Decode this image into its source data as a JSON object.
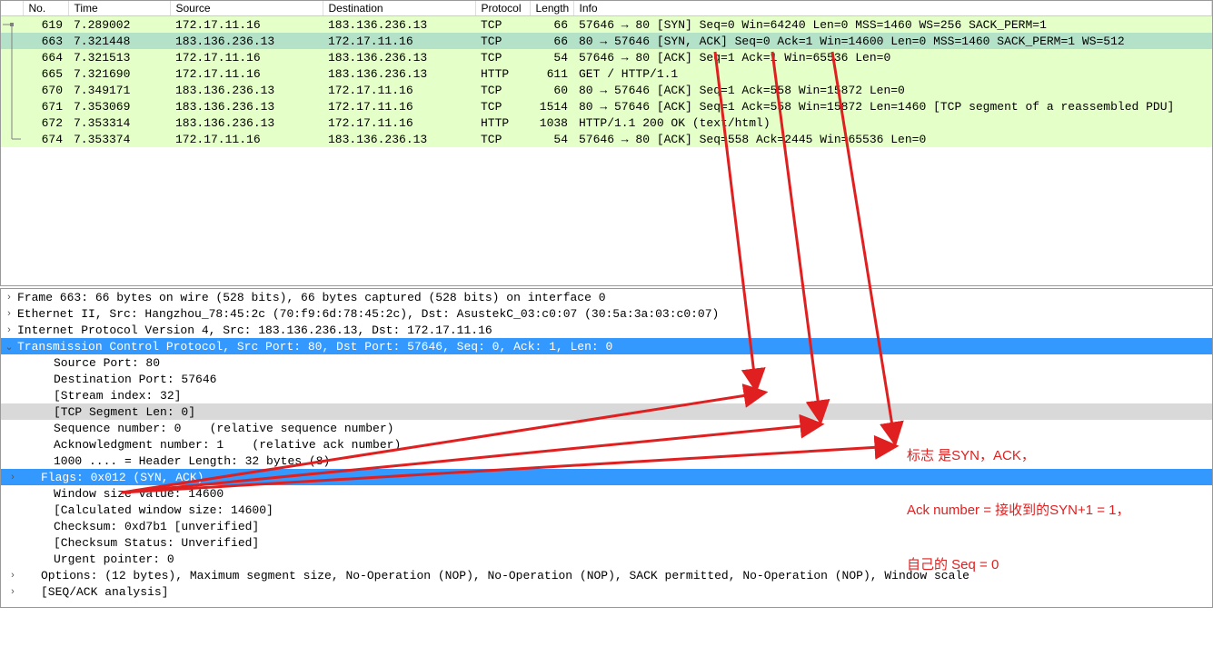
{
  "packet_list": {
    "headers": {
      "no": "No.",
      "time": "Time",
      "source": "Source",
      "destination": "Destination",
      "protocol": "Protocol",
      "length": "Length",
      "info": "Info"
    },
    "rows": [
      {
        "glyph": "start",
        "cls": "row-green",
        "no": "619",
        "time": "7.289002",
        "src": "172.17.11.16",
        "dst": "183.136.236.13",
        "proto": "TCP",
        "len": "66",
        "info": "57646 → 80 [SYN] Seq=0 Win=64240 Len=0 MSS=1460 WS=256 SACK_PERM=1"
      },
      {
        "glyph": "mid",
        "cls": "row-teal",
        "no": "663",
        "time": "7.321448",
        "src": "183.136.236.13",
        "dst": "172.17.11.16",
        "proto": "TCP",
        "len": "66",
        "info": "80 → 57646 [SYN, ACK] Seq=0 Ack=1 Win=14600 Len=0 MSS=1460 SACK_PERM=1 WS=512"
      },
      {
        "glyph": "mid",
        "cls": "row-green",
        "no": "664",
        "time": "7.321513",
        "src": "172.17.11.16",
        "dst": "183.136.236.13",
        "proto": "TCP",
        "len": "54",
        "info": "57646 → 80 [ACK] Seq=1 Ack=1 Win=65536 Len=0"
      },
      {
        "glyph": "mid",
        "cls": "row-green",
        "no": "665",
        "time": "7.321690",
        "src": "172.17.11.16",
        "dst": "183.136.236.13",
        "proto": "HTTP",
        "len": "611",
        "info": "GET / HTTP/1.1 "
      },
      {
        "glyph": "mid",
        "cls": "row-green",
        "no": "670",
        "time": "7.349171",
        "src": "183.136.236.13",
        "dst": "172.17.11.16",
        "proto": "TCP",
        "len": "60",
        "info": "80 → 57646 [ACK] Seq=1 Ack=558 Win=15872 Len=0"
      },
      {
        "glyph": "mid",
        "cls": "row-green",
        "no": "671",
        "time": "7.353069",
        "src": "183.136.236.13",
        "dst": "172.17.11.16",
        "proto": "TCP",
        "len": "1514",
        "info": "80 → 57646 [ACK] Seq=1 Ack=558 Win=15872 Len=1460 [TCP segment of a reassembled PDU]"
      },
      {
        "glyph": "mid",
        "cls": "row-green",
        "no": "672",
        "time": "7.353314",
        "src": "183.136.236.13",
        "dst": "172.17.11.16",
        "proto": "HTTP",
        "len": "1038",
        "info": "HTTP/1.1 200 OK  (text/html)"
      },
      {
        "glyph": "end",
        "cls": "row-green",
        "no": "674",
        "time": "7.353374",
        "src": "172.17.11.16",
        "dst": "183.136.236.13",
        "proto": "TCP",
        "len": "54",
        "info": "57646 → 80 [ACK] Seq=558 Ack=2445 Win=65536 Len=0"
      }
    ]
  },
  "details": [
    {
      "type": "top",
      "expander": ">",
      "text": "Frame 663: 66 bytes on wire (528 bits), 66 bytes captured (528 bits) on interface 0"
    },
    {
      "type": "top",
      "expander": ">",
      "text": "Ethernet II, Src: Hangzhou_78:45:2c (70:f9:6d:78:45:2c), Dst: AsustekC_03:c0:07 (30:5a:3a:03:c0:07)"
    },
    {
      "type": "top",
      "expander": ">",
      "text": "Internet Protocol Version 4, Src: 183.136.236.13, Dst: 172.17.11.16"
    },
    {
      "type": "top",
      "expander": "v",
      "sel": "blue",
      "text": "Transmission Control Protocol, Src Port: 80, Dst Port: 57646, Seq: 0, Ack: 1, Len: 0"
    },
    {
      "type": "sub",
      "indent": 2,
      "text": "Source Port: 80"
    },
    {
      "type": "sub",
      "indent": 2,
      "text": "Destination Port: 57646"
    },
    {
      "type": "sub",
      "indent": 2,
      "text": "[Stream index: 32]"
    },
    {
      "type": "sub",
      "indent": 2,
      "sel": "gray",
      "text": "[TCP Segment Len: 0]"
    },
    {
      "type": "sub",
      "indent": 2,
      "text": "Sequence number: 0    (relative sequence number)"
    },
    {
      "type": "sub",
      "indent": 2,
      "text": "Acknowledgment number: 1    (relative ack number)"
    },
    {
      "type": "sub",
      "indent": 2,
      "text": "1000 .... = Header Length: 32 bytes (8)"
    },
    {
      "type": "sub",
      "indent": 1,
      "expander": ">",
      "sel": "blue",
      "text": "Flags: 0x012 (SYN, ACK)"
    },
    {
      "type": "sub",
      "indent": 2,
      "text": "Window size value: 14600"
    },
    {
      "type": "sub",
      "indent": 2,
      "text": "[Calculated window size: 14600]"
    },
    {
      "type": "sub",
      "indent": 2,
      "text": "Checksum: 0xd7b1 [unverified]"
    },
    {
      "type": "sub",
      "indent": 2,
      "text": "[Checksum Status: Unverified]"
    },
    {
      "type": "sub",
      "indent": 2,
      "text": "Urgent pointer: 0"
    },
    {
      "type": "sub",
      "indent": 1,
      "expander": ">",
      "text": "Options: (12 bytes), Maximum segment size, No-Operation (NOP), No-Operation (NOP), SACK permitted, No-Operation (NOP), Window scale"
    },
    {
      "type": "sub",
      "indent": 1,
      "expander": ">",
      "text": "[SEQ/ACK analysis]"
    }
  ],
  "annotation": {
    "line1": "标志 是SYN，ACK，",
    "line2": "Ack number = 接收到的SYN+1 = 1，",
    "line3": "自己的 Seq = 0"
  }
}
